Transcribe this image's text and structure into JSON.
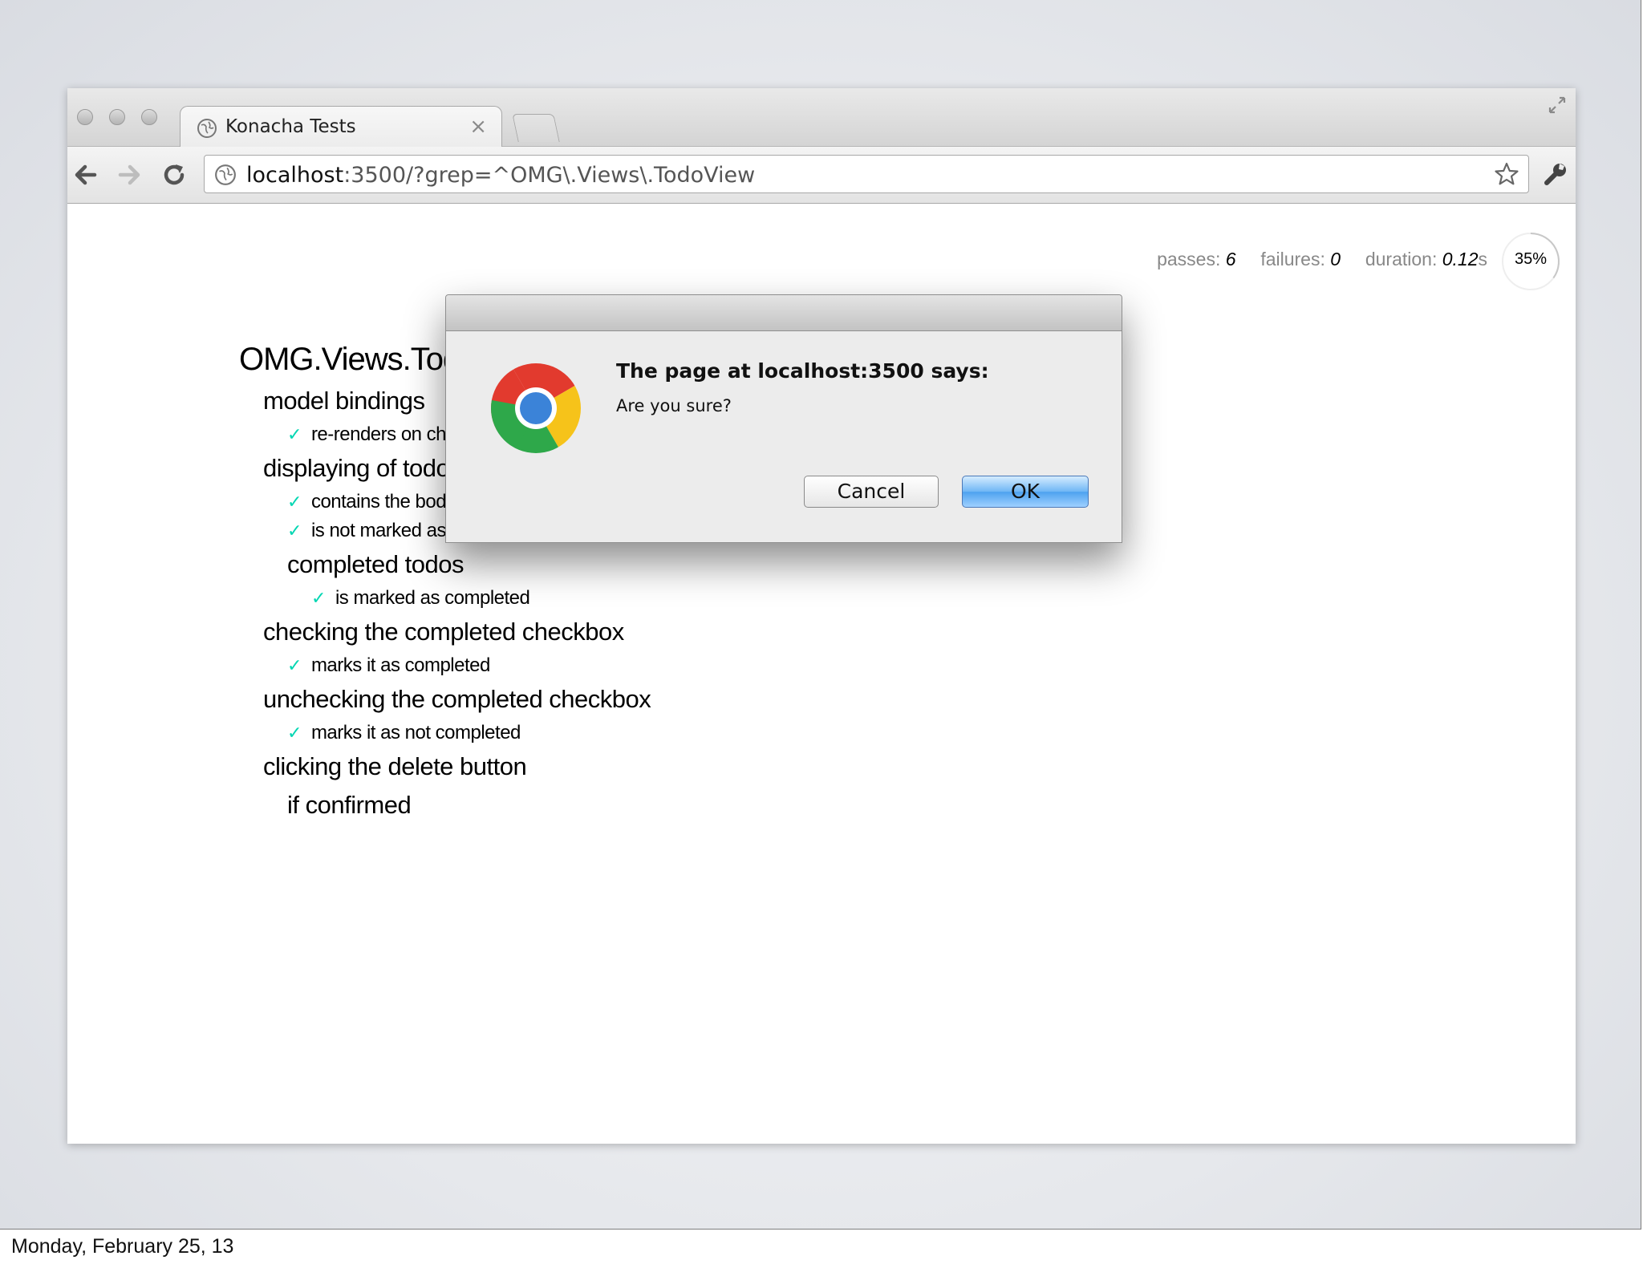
{
  "browser": {
    "tab_title": "Konacha Tests",
    "tab_close": "×",
    "url_host": "localhost",
    "url_rest": ":3500/?grep=^OMG\\.Views\\.TodoView"
  },
  "stats": {
    "passes_label": "passes:",
    "passes": "6",
    "failures_label": "failures:",
    "failures": "0",
    "duration_label": "duration:",
    "duration": "0.12",
    "duration_unit": "s",
    "progress": "35%",
    "progress_fraction": 0.35
  },
  "suite": {
    "title": "OMG.Views.TodoVi",
    "groups": [
      {
        "title": "model bindings",
        "tests": [
          "re-renders on change"
        ]
      },
      {
        "title": "displaying of todos",
        "tests": [
          "contains the body of th",
          "is not marked as compl"
        ]
      },
      {
        "title": "completed todos",
        "tests": [
          "is marked as completed"
        ]
      },
      {
        "title": "checking the completed checkbox",
        "tests": [
          "marks it as completed"
        ]
      },
      {
        "title": "unchecking the completed checkbox",
        "tests": [
          "marks it as not completed"
        ]
      },
      {
        "title": "clicking the delete button",
        "tests": []
      },
      {
        "title": "if confirmed",
        "tests": []
      }
    ],
    "check_glyph": "✓"
  },
  "dialog": {
    "heading": "The page at localhost:3500 says:",
    "message": "Are you sure?",
    "cancel_label": "Cancel",
    "ok_label": "OK"
  },
  "footer": {
    "date": "Monday, February 25, 13"
  },
  "icons": {
    "back": "back-arrow-icon",
    "forward": "forward-arrow-icon",
    "reload": "reload-icon",
    "globe": "globe-icon",
    "star": "star-icon",
    "wrench": "wrench-icon",
    "chrome": "chrome-logo-icon"
  },
  "colors": {
    "check": "#00d6b2",
    "ok_button": "#4da2ef"
  }
}
